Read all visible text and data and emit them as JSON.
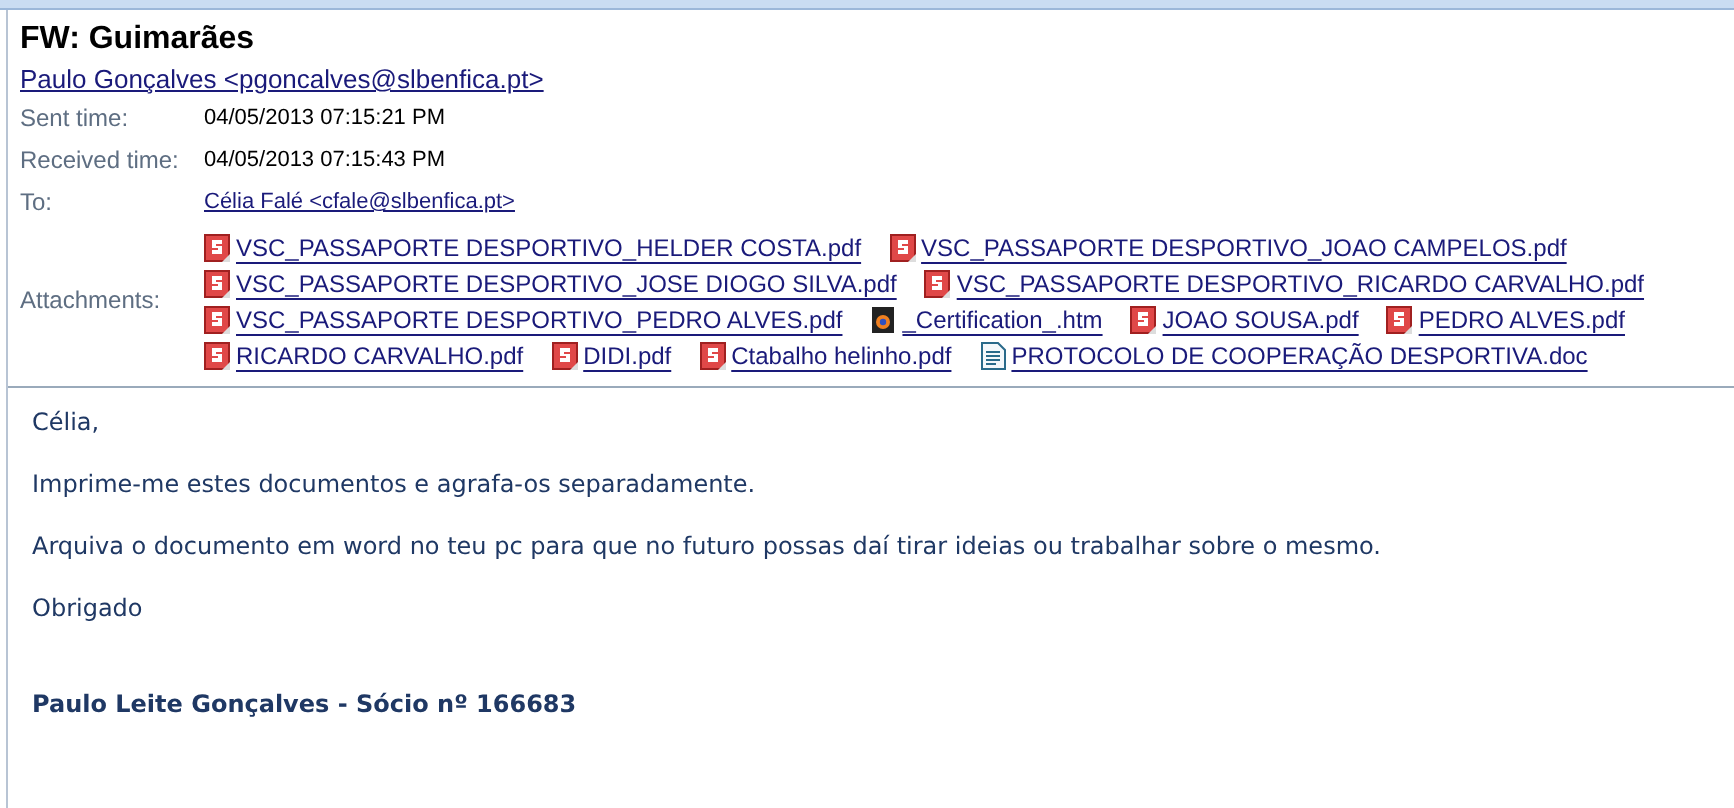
{
  "message": {
    "subject": "FW: Guimarães",
    "from": "Paulo Gonçalves <pgoncalves@slbenfica.pt>",
    "fields": [
      {
        "label": "Sent time:",
        "value": "04/05/2013 07:15:21 PM",
        "kind": "text"
      },
      {
        "label": "Received time:",
        "value": "04/05/2013 07:15:43 PM",
        "kind": "text"
      },
      {
        "label": "To:",
        "value": "Célia Falé <cfale@slbenfica.pt>",
        "kind": "link"
      }
    ],
    "attachments_label": "Attachments:",
    "attachment_rows": [
      {
        "items": [
          {
            "name": "VSC_PASSAPORTE DESPORTIVO_HELDER COSTA.pdf",
            "kind": "pdf"
          },
          {
            "name": "VSC_PASSAPORTE DESPORTIVO_JOAO CAMPELOS.pdf",
            "kind": "pdf"
          }
        ]
      },
      {
        "items": [
          {
            "name": "VSC_PASSAPORTE DESPORTIVO_JOSE DIOGO SILVA.pdf",
            "kind": "pdf"
          },
          {
            "name": "VSC_PASSAPORTE DESPORTIVO_RICARDO CARVALHO.pdf",
            "kind": "pdf"
          }
        ]
      },
      {
        "items": [
          {
            "name": "VSC_PASSAPORTE DESPORTIVO_PEDRO ALVES.pdf",
            "kind": "pdf"
          },
          {
            "name": "_Certification_.htm",
            "kind": "htm"
          },
          {
            "name": "JOAO SOUSA.pdf",
            "kind": "pdf"
          },
          {
            "name": "PEDRO ALVES.pdf",
            "kind": "pdf"
          }
        ]
      },
      {
        "items": [
          {
            "name": "RICARDO CARVALHO.pdf",
            "kind": "pdf"
          },
          {
            "name": "DIDI.pdf",
            "kind": "pdf"
          },
          {
            "name": "Ctabalho helinho.pdf",
            "kind": "pdf"
          },
          {
            "name": "PROTOCOLO DE COOPERAÇÃO DESPORTIVA.doc",
            "kind": "doc"
          }
        ]
      }
    ],
    "body": [
      "Célia,",
      "Imprime-me estes documentos e agrafa-os separadamente.",
      "Arquiva o documento em word no teu pc para que no futuro possas daí tirar ideias ou trabalhar sobre o mesmo.",
      "Obrigado"
    ],
    "signature": "Paulo Leite Gonçalves - Sócio nº 166683"
  }
}
